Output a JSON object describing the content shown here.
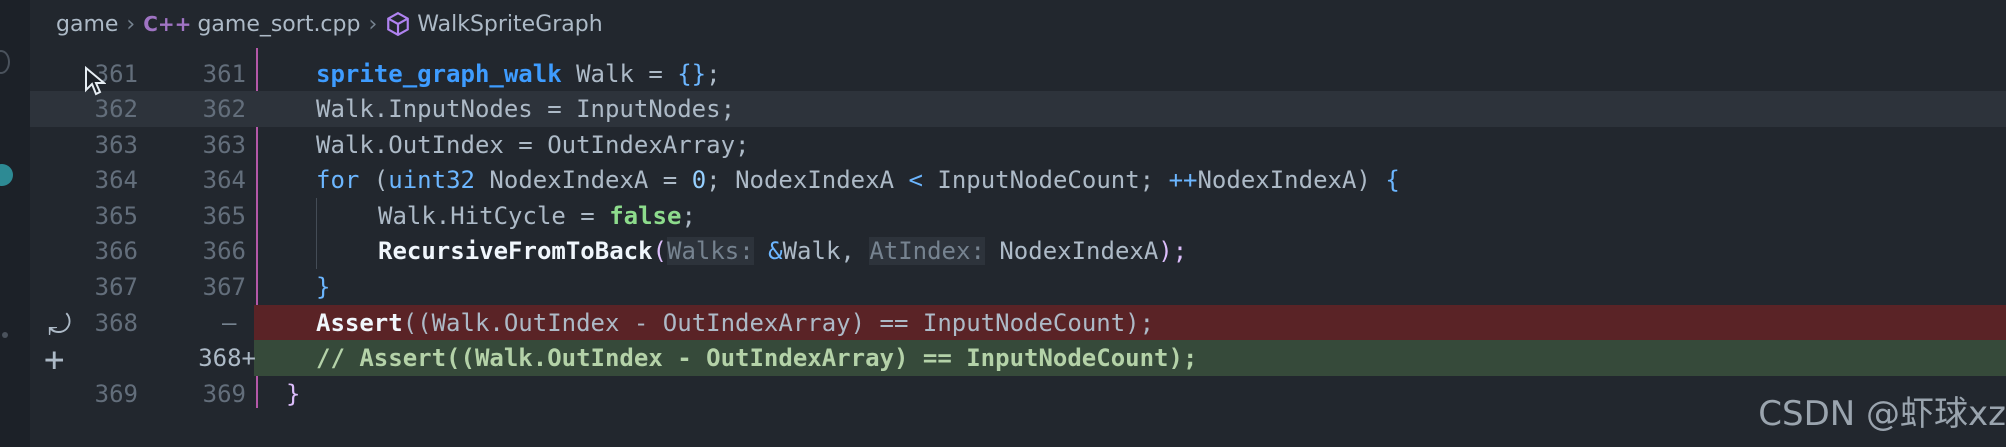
{
  "breadcrumb": {
    "folder": "game",
    "file_icon": "C++",
    "file": "game_sort.cpp",
    "symbol": "WalkSpriteGraph"
  },
  "lines": [
    {
      "a": "361",
      "b": "361"
    },
    {
      "a": "362",
      "b": "362"
    },
    {
      "a": "363",
      "b": "363"
    },
    {
      "a": "364",
      "b": "364"
    },
    {
      "a": "365",
      "b": "365"
    },
    {
      "a": "366",
      "b": "366"
    },
    {
      "a": "367",
      "b": "367"
    },
    {
      "a": "368",
      "b": "",
      "marker": "—"
    },
    {
      "a": "",
      "b": "368+",
      "marker": ""
    },
    {
      "a": "369",
      "b": "369"
    }
  ],
  "code": {
    "l361_type": "sprite_graph_walk",
    "l361_rest": " Walk = ",
    "l361_init": "{}",
    "l361_end": ";",
    "l362": "Walk.InputNodes = InputNodes;",
    "l363": "Walk.OutIndex = OutIndexArray;",
    "l364_for": "for",
    "l364_a": " (",
    "l364_ty": "uint32",
    "l364_b": " NodexIndexA = ",
    "l364_zero": "0",
    "l364_c": "; NodexIndexA ",
    "l364_lt": "<",
    "l364_d": " InputNodeCount; ",
    "l364_inc": "++",
    "l364_e": "NodexIndexA) ",
    "l364_brace": "{",
    "l365_a": "Walk.HitCycle = ",
    "l365_false": "false",
    "l365_end": ";",
    "l366_fn": "RecursiveFromToBack",
    "l366_p": "(",
    "l366_h1": "Walks:",
    "l366_amp": " &",
    "l366_a": "Walk, ",
    "l366_h2": "AtIndex:",
    "l366_b": " NodexIndexA",
    "l366_end": ");",
    "l367": "}",
    "l368_fn": "Assert",
    "l368_rest": "((Walk.OutIndex - OutIndexArray) == InputNodeCount);",
    "l368b": "// Assert((Walk.OutIndex - OutIndexArray) == InputNodeCount);",
    "l369": "}"
  },
  "watermark": "CSDN @虾球xz",
  "icons": [
    "cursor-icon",
    "revert-icon",
    "plus-icon",
    "cpp-file-icon",
    "symbol-class-icon",
    "chevron-right-icon"
  ]
}
